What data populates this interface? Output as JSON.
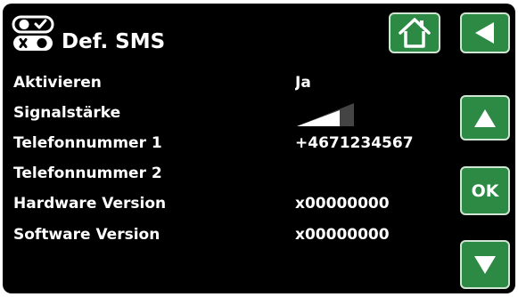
{
  "header": {
    "title": "Def. SMS",
    "title_icon": "sms-toggle-icon"
  },
  "nav": {
    "home_icon": "home-icon",
    "back_icon": "back-arrow-icon",
    "up_icon": "up-arrow-icon",
    "ok_label": "OK",
    "down_icon": "down-arrow-icon"
  },
  "rows": [
    {
      "label": "Aktivieren",
      "value": "Ja"
    },
    {
      "label": "Signalstärke",
      "value_icon": "signal-strength-icon",
      "signal_level_fraction": 0.75
    },
    {
      "label": "Telefonnummer 1",
      "value": "+4671234567"
    },
    {
      "label": "Telefonnummer 2",
      "value": ""
    },
    {
      "label": "Hardware Version",
      "value": "x00000000"
    },
    {
      "label": "Software Version",
      "value": "x00000000"
    }
  ],
  "colors": {
    "background": "#000000",
    "text": "#ffffff",
    "button_green": "#2c8a44",
    "button_border": "#cfe6d4"
  }
}
